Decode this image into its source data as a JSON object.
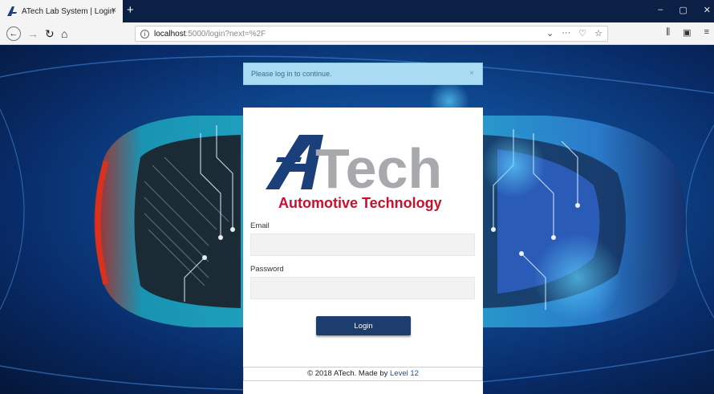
{
  "browser": {
    "tab_title": "ATech Lab System | Login",
    "tab_close": "×",
    "new_tab": "+",
    "url_host": "localhost",
    "url_path": ":5000/login?next=%2F",
    "window_controls": [
      "–",
      "▢",
      "✕"
    ]
  },
  "flash": {
    "message": "Please log in to continue.",
    "close": "×"
  },
  "logo": {
    "brand_a": "A",
    "brand_rest": "Tech",
    "tagline": "Automotive Technology",
    "colors": {
      "navy": "#1b3f7a",
      "gray": "#a7a9ac",
      "red": "#c8102e"
    }
  },
  "form": {
    "email_label": "Email",
    "email_value": "",
    "password_label": "Password",
    "password_value": "",
    "submit_label": "Login"
  },
  "footer": {
    "text": "© 2018 ATech. Made by ",
    "link": "Level 12"
  }
}
